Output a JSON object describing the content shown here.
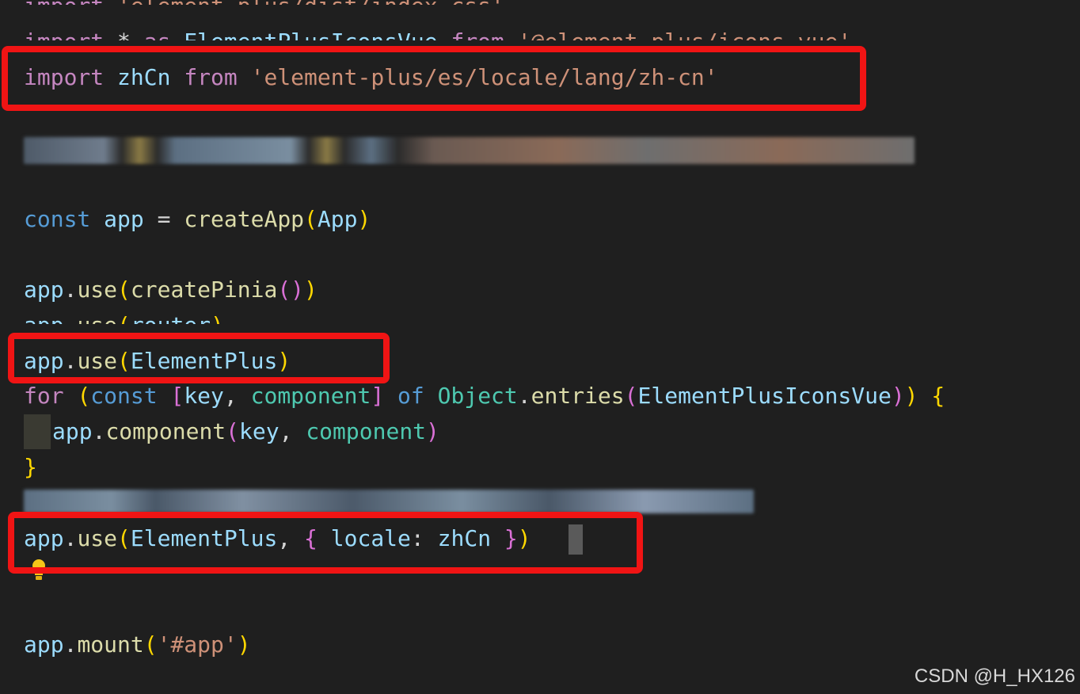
{
  "editor": {
    "background": "#1f1f1f",
    "highlight_color": "#f01414",
    "lines": [
      {
        "clipped": true,
        "tokens": [
          {
            "text": "import",
            "cls": "tok-kw"
          },
          {
            "text": " ",
            "cls": "tok-punc"
          },
          {
            "text": "'element-plus/dist/index.css'",
            "cls": "tok-str"
          }
        ]
      },
      {
        "clipped": true,
        "tokens": [
          {
            "text": "import",
            "cls": "tok-kw"
          },
          {
            "text": " * ",
            "cls": "tok-punc"
          },
          {
            "text": "as",
            "cls": "tok-kw"
          },
          {
            "text": " ",
            "cls": "tok-punc"
          },
          {
            "text": "ElementPlusIconsVue",
            "cls": "tok-var"
          },
          {
            "text": " ",
            "cls": "tok-punc"
          },
          {
            "text": "from",
            "cls": "tok-kw"
          },
          {
            "text": " ",
            "cls": "tok-punc"
          },
          {
            "text": "'@element-plus/icons-vue'",
            "cls": "tok-str"
          }
        ]
      },
      {
        "tokens": [
          {
            "text": "import",
            "cls": "tok-kw"
          },
          {
            "text": " ",
            "cls": "tok-punc"
          },
          {
            "text": "zhCn",
            "cls": "tok-var"
          },
          {
            "text": " ",
            "cls": "tok-punc"
          },
          {
            "text": "from",
            "cls": "tok-kw"
          },
          {
            "text": " ",
            "cls": "tok-punc"
          },
          {
            "text": "'element-plus/es/locale/lang/zh-cn'",
            "cls": "tok-str"
          }
        ]
      },
      {
        "tokens": [
          {
            "text": "const",
            "cls": "tok-decl"
          },
          {
            "text": " ",
            "cls": "tok-punc"
          },
          {
            "text": "app",
            "cls": "tok-var"
          },
          {
            "text": " = ",
            "cls": "tok-punc"
          },
          {
            "text": "createApp",
            "cls": "tok-fn"
          },
          {
            "text": "(",
            "cls": "br1"
          },
          {
            "text": "App",
            "cls": "tok-var"
          },
          {
            "text": ")",
            "cls": "br1"
          }
        ]
      },
      {
        "tokens": [
          {
            "text": "app",
            "cls": "tok-var"
          },
          {
            "text": ".",
            "cls": "tok-punc"
          },
          {
            "text": "use",
            "cls": "tok-fn"
          },
          {
            "text": "(",
            "cls": "br1"
          },
          {
            "text": "createPinia",
            "cls": "tok-fn"
          },
          {
            "text": "()",
            "cls": "br2"
          },
          {
            "text": ")",
            "cls": "br1"
          }
        ]
      },
      {
        "clipped": true,
        "tokens": [
          {
            "text": "app",
            "cls": "tok-var"
          },
          {
            "text": ".",
            "cls": "tok-punc"
          },
          {
            "text": "use",
            "cls": "tok-fn"
          },
          {
            "text": "(",
            "cls": "br1"
          },
          {
            "text": "router",
            "cls": "tok-var"
          },
          {
            "text": ")",
            "cls": "br1"
          }
        ]
      },
      {
        "tokens": [
          {
            "text": "app",
            "cls": "tok-var"
          },
          {
            "text": ".",
            "cls": "tok-punc"
          },
          {
            "text": "use",
            "cls": "tok-fn"
          },
          {
            "text": "(",
            "cls": "br1"
          },
          {
            "text": "ElementPlus",
            "cls": "tok-var"
          },
          {
            "text": ")",
            "cls": "br1"
          }
        ]
      },
      {
        "tokens": [
          {
            "text": "for",
            "cls": "tok-kw"
          },
          {
            "text": " ",
            "cls": "tok-punc"
          },
          {
            "text": "(",
            "cls": "br1"
          },
          {
            "text": "const",
            "cls": "tok-decl"
          },
          {
            "text": " ",
            "cls": "tok-punc"
          },
          {
            "text": "[",
            "cls": "br2"
          },
          {
            "text": "key",
            "cls": "tok-var"
          },
          {
            "text": ", ",
            "cls": "tok-punc"
          },
          {
            "text": "component",
            "cls": "tok-type"
          },
          {
            "text": "]",
            "cls": "br2"
          },
          {
            "text": " ",
            "cls": "tok-punc"
          },
          {
            "text": "of",
            "cls": "tok-decl"
          },
          {
            "text": " ",
            "cls": "tok-punc"
          },
          {
            "text": "Object",
            "cls": "tok-type"
          },
          {
            "text": ".",
            "cls": "tok-punc"
          },
          {
            "text": "entries",
            "cls": "tok-fn"
          },
          {
            "text": "(",
            "cls": "br2"
          },
          {
            "text": "ElementPlusIconsVue",
            "cls": "tok-var"
          },
          {
            "text": ")",
            "cls": "br2"
          },
          {
            "text": ")",
            "cls": "br1"
          },
          {
            "text": " ",
            "cls": "tok-punc"
          },
          {
            "text": "{",
            "cls": "br1"
          }
        ]
      },
      {
        "tokens": [
          {
            "text": "app",
            "cls": "tok-var"
          },
          {
            "text": ".",
            "cls": "tok-punc"
          },
          {
            "text": "component",
            "cls": "tok-fn"
          },
          {
            "text": "(",
            "cls": "br2"
          },
          {
            "text": "key",
            "cls": "tok-var"
          },
          {
            "text": ", ",
            "cls": "tok-punc"
          },
          {
            "text": "component",
            "cls": "tok-type"
          },
          {
            "text": ")",
            "cls": "br2"
          }
        ]
      },
      {
        "tokens": [
          {
            "text": "}",
            "cls": "br1"
          }
        ]
      },
      {
        "tokens": [
          {
            "text": "app",
            "cls": "tok-var"
          },
          {
            "text": ".",
            "cls": "tok-punc"
          },
          {
            "text": "use",
            "cls": "tok-fn"
          },
          {
            "text": "(",
            "cls": "br1"
          },
          {
            "text": "ElementPlus",
            "cls": "tok-var"
          },
          {
            "text": ", ",
            "cls": "tok-punc"
          },
          {
            "text": "{",
            "cls": "br2"
          },
          {
            "text": " ",
            "cls": "tok-punc"
          },
          {
            "text": "locale",
            "cls": "tok-var"
          },
          {
            "text": ": ",
            "cls": "tok-punc"
          },
          {
            "text": "zhCn",
            "cls": "tok-var"
          },
          {
            "text": " ",
            "cls": "tok-punc"
          },
          {
            "text": "}",
            "cls": "br2"
          },
          {
            "text": ")",
            "cls": "br1"
          }
        ]
      },
      {
        "tokens": [
          {
            "text": "app",
            "cls": "tok-var"
          },
          {
            "text": ".",
            "cls": "tok-punc"
          },
          {
            "text": "mount",
            "cls": "tok-fn"
          },
          {
            "text": "(",
            "cls": "br1"
          },
          {
            "text": "'#app'",
            "cls": "tok-str"
          },
          {
            "text": ")",
            "cls": "br1"
          }
        ]
      }
    ]
  },
  "watermark": {
    "text": "CSDN @H_HX126"
  }
}
